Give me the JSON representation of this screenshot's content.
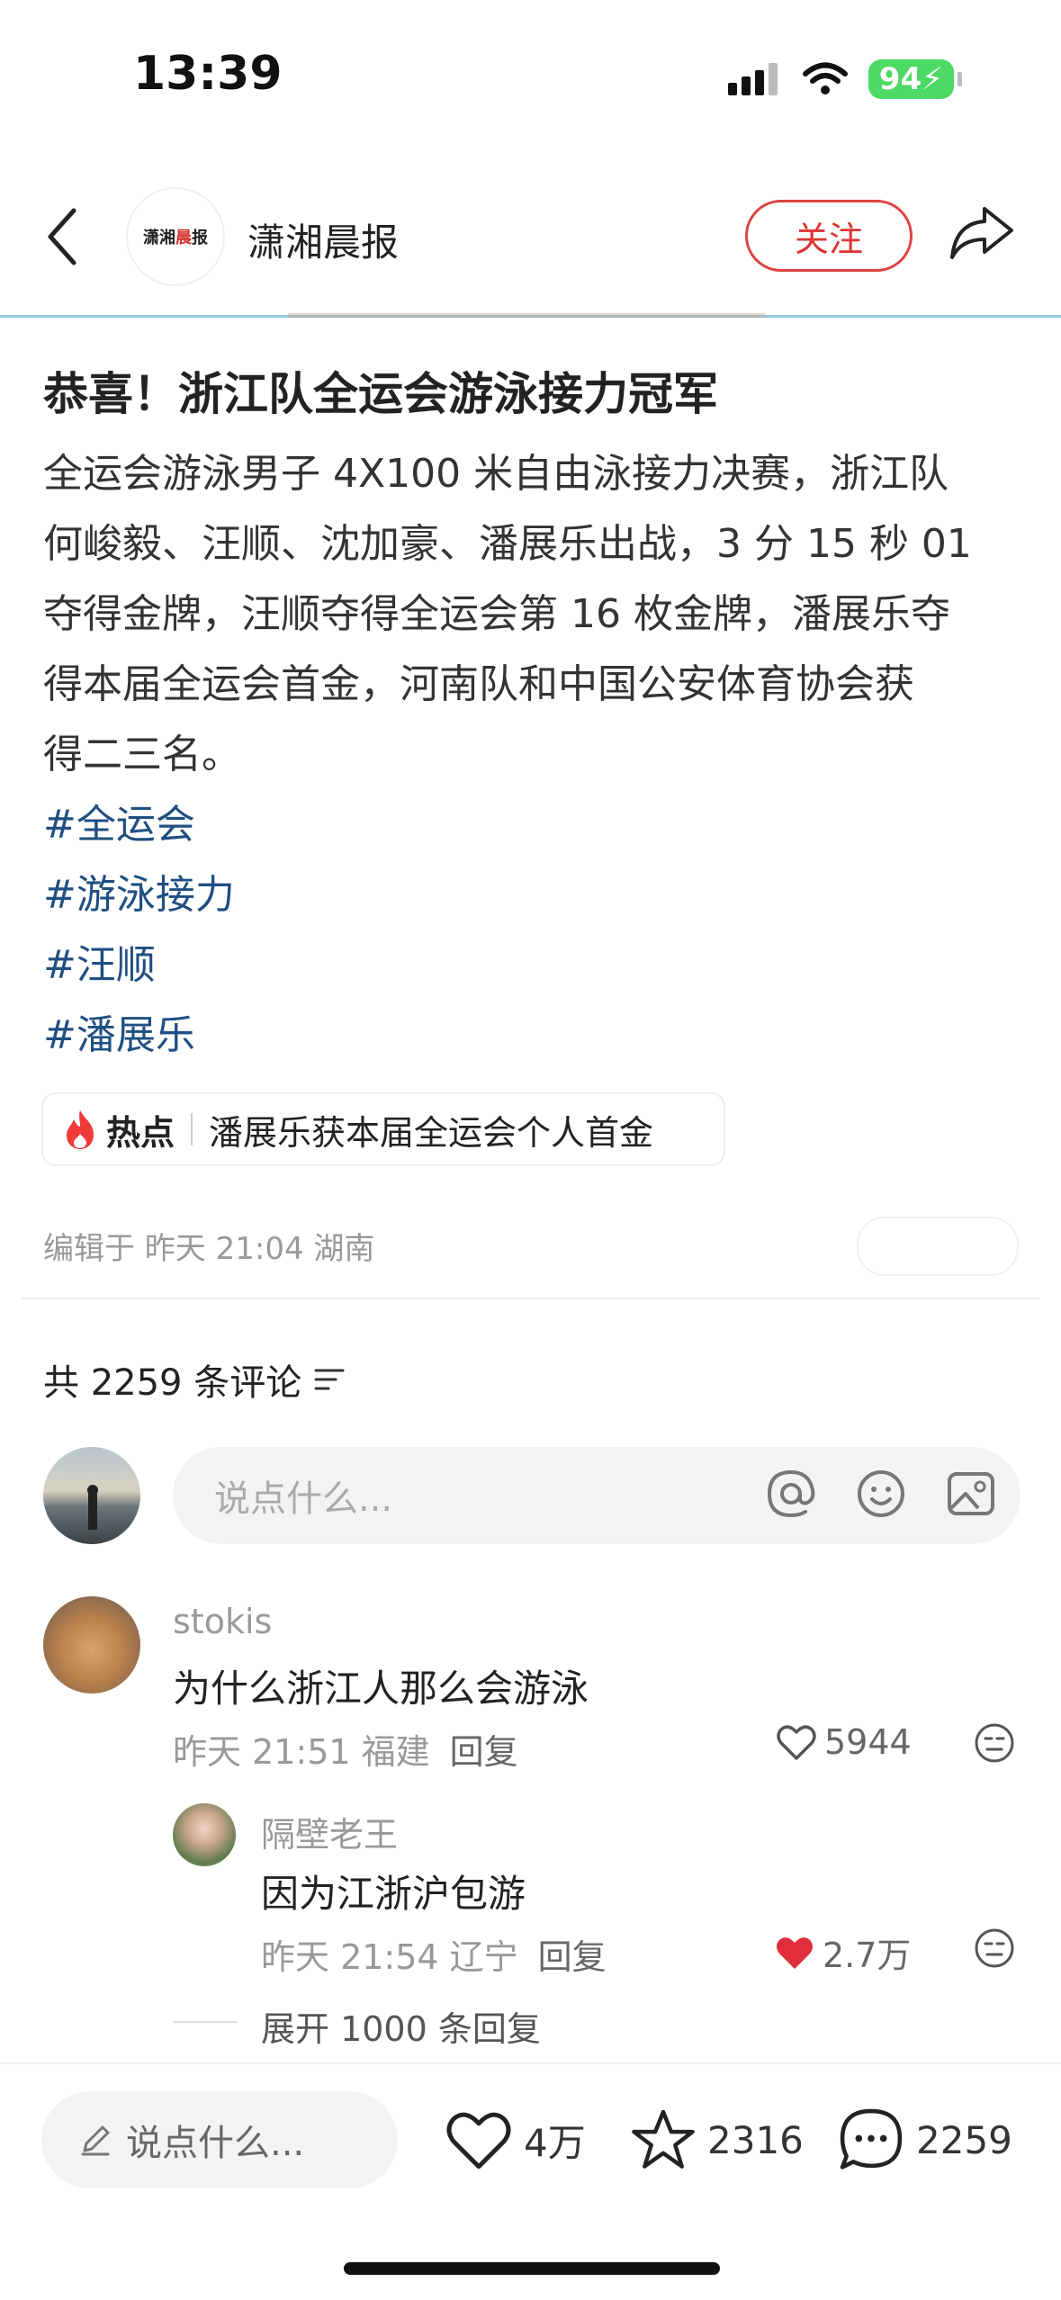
{
  "status_bar": {
    "time": "13:39",
    "battery": "94"
  },
  "header": {
    "account_name": "潇湘晨报",
    "logo_text_a": "潇湘",
    "logo_text_b": "晨",
    "logo_text_c": "报",
    "follow_label": "关注"
  },
  "post": {
    "title": "恭喜！浙江队全运会游泳接力冠军",
    "body_lines": [
      "全运会游泳男子 4X100 米自由泳接力决赛，浙江队",
      "何峻毅、汪顺、沈加豪、潘展乐出战，3 分 15 秒 01",
      "夺得金牌，汪顺夺得全运会第 16 枚金牌，潘展乐夺",
      "得本届全运会首金，河南队和中国公安体育协会获",
      "得二三名。"
    ],
    "hashtags": [
      "#全运会",
      "#游泳接力",
      "#汪顺",
      "#潘展乐"
    ],
    "hot": {
      "label": "热点",
      "text": "潘展乐获本届全运会个人首金"
    },
    "edit_meta": "编辑于 昨天 21:04 湖南"
  },
  "comments_section": {
    "count_label": "共 2259 条评论",
    "input_placeholder": "说点什么...",
    "comments": [
      {
        "user": "stokis",
        "text": "为什么浙江人那么会游泳",
        "meta": "昨天 21:51 福建",
        "reply_label": "回复",
        "likes": "5944",
        "liked": false
      },
      {
        "user": "隔壁老王",
        "text": "因为江浙沪包游",
        "meta": "昨天 21:54 辽宁",
        "reply_label": "回复",
        "likes": "2.7万",
        "liked": true
      }
    ],
    "expand_label": "展开 1000 条回复"
  },
  "bottom_bar": {
    "input_placeholder": "说点什么...",
    "likes": "4万",
    "favorites": "2316",
    "comments": "2259"
  },
  "colors": {
    "accent_red": "#e02e3c",
    "hashtag_blue": "#1f4f82",
    "battery_green": "#4cd964"
  }
}
